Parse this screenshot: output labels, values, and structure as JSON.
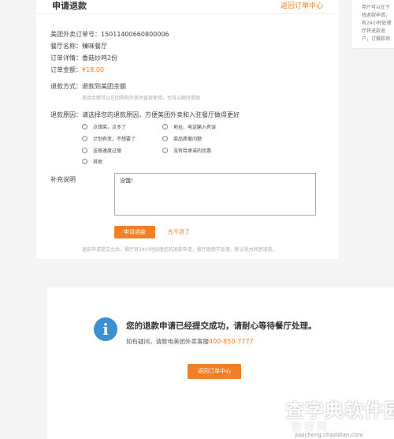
{
  "refund_form": {
    "title": "申请退款",
    "back_link": "返回订单中心",
    "order_id": "美团外卖订单号：15011400660800006",
    "restaurant": "餐厅名称：臻味餐厅",
    "order_detail": "订单详情：香菇炒鸡2份",
    "amount_label": "订单金额：",
    "amount_value": "¥18.00",
    "refund_method": "退款方式：退款到美团余额",
    "refund_method_hint": "美团余额可以在团购和外卖时直接使用，也可以随时提现",
    "refund_reason_prompt": "退款原因：请选择您的退款原因，方便美团外卖和入驻餐厅做得更好",
    "reasons": [
      "点错菜，点多了",
      "地址、电话输入有误",
      "计划有变，不想要了",
      "菜品质量问题",
      "送餐速度过慢",
      "没有给承诺的优惠",
      "其他"
    ],
    "note_label": "补充说明",
    "note_value": "没饿！",
    "submit_label": "申请退款",
    "cancel_label": "先不退了",
    "footnote": "退款申请提交之后，餐厅有24小时处理您的退款申请，餐厅逾期不处理，默认视为同意退款。"
  },
  "side_note": {
    "lines": [
      "用户可以在下",
      "线退款申请，",
      "有24小时处理",
      "厅将退款退",
      "户，订餐款项"
    ]
  },
  "success": {
    "icon": "info-icon",
    "icon_glyph": "i",
    "title": "您的退款申请已经提交成功，请耐心等待餐厅处理。",
    "help_prefix": "如有疑问，请致电美团外卖客服",
    "phone": "400-850-7777",
    "back_button": "返回订单中心"
  },
  "watermark": {
    "title": "查字典软件园",
    "subtitle": "教程网",
    "url": "jiaocheng.chazidian.com"
  },
  "colors": {
    "accent": "#f27f25",
    "info_blue": "#3d8fd0",
    "background": "#f4f4f4"
  }
}
